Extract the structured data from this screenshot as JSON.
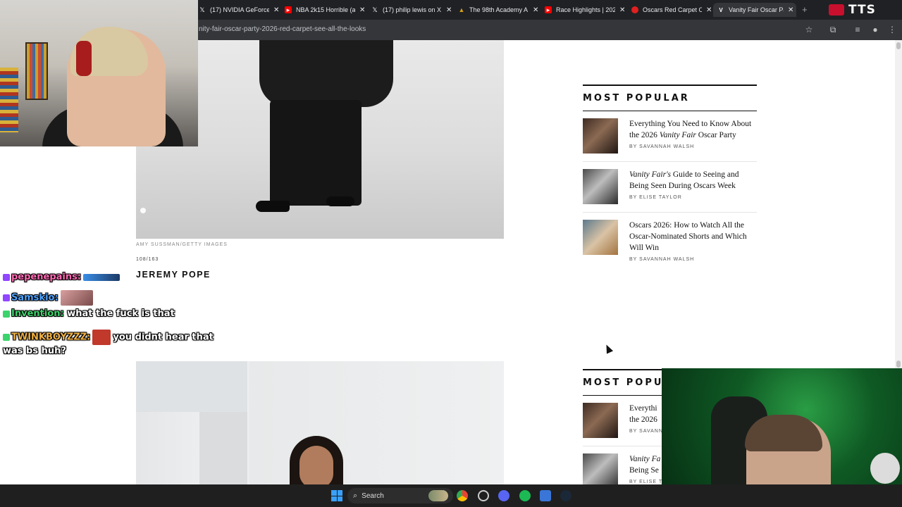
{
  "browser": {
    "tabs": [
      {
        "label": "(17) NVIDIA GeForce",
        "icon": "x-logo-icon",
        "color": "#000000"
      },
      {
        "label": "NBA 2k15 Horrible (a",
        "icon": "youtube-icon",
        "color": "#ff0000"
      },
      {
        "label": "(17) philip lewis on X",
        "icon": "x-logo-icon",
        "color": "#000000"
      },
      {
        "label": "The 98th Academy A",
        "icon": "academy-icon",
        "color": "#d4a017"
      },
      {
        "label": "Race Highlights | 202",
        "icon": "youtube-icon",
        "color": "#ff0000"
      },
      {
        "label": "Oscars Red Carpet O",
        "icon": "red-circle-icon",
        "color": "#e02020"
      },
      {
        "label": "Vanity Fair Oscar Part",
        "icon": "vf-icon",
        "color": "#000000"
      }
    ],
    "url": "nity-fair-oscar-party-2026-red-carpet-see-all-the-looks",
    "tts_label": "TTS"
  },
  "article": {
    "photo_credit": "AMY SUSSMAN/GETTY IMAGES",
    "counter": "108/163",
    "caption": "JEREMY POPE"
  },
  "sidebar": {
    "title": "MOST POPULAR",
    "title_repeat": "MOST POPUL",
    "items": [
      {
        "headline_pre": "Everything You Need to Know About the 2026 ",
        "headline_em": "Vanity Fair",
        "headline_post": " Oscar Party",
        "byline": "BY SAVANNAH WALSH"
      },
      {
        "headline_pre": "",
        "headline_em": "Vanity Fair's",
        "headline_post": " Guide to Seeing and Being Seen During Oscars Week",
        "byline": "BY ELISE TAYLOR"
      },
      {
        "headline_pre": "Oscars 2026: How to Watch All the Oscar-Nominated Shorts and Which Will Win",
        "headline_em": "",
        "headline_post": "",
        "byline": "BY SAVANNAH WALSH"
      }
    ],
    "partial_items": [
      {
        "line1": "Everythi",
        "line2": "the 2026",
        "byline": "BY SAVANN"
      },
      {
        "line1": "Vanity Fa",
        "line2": "Being Se",
        "byline": "BY ELISE T"
      }
    ]
  },
  "chat": [
    {
      "user": "pepenepains:",
      "message": "",
      "user_color": "#ff69b4"
    },
    {
      "user": "Samskio:",
      "message": "",
      "user_color": "#4fa3ff"
    },
    {
      "user": "Invention:",
      "message": "what the fuck is that",
      "user_color": "#3bd36b"
    },
    {
      "user": "TWINKBOYZZZ:",
      "message": "you didnt hear that",
      "user_color": "#f0b040"
    },
    {
      "user": "",
      "message": "was bs huh?",
      "user_color": "#ffffff"
    }
  ],
  "taskbar": {
    "search_label": "Search"
  }
}
